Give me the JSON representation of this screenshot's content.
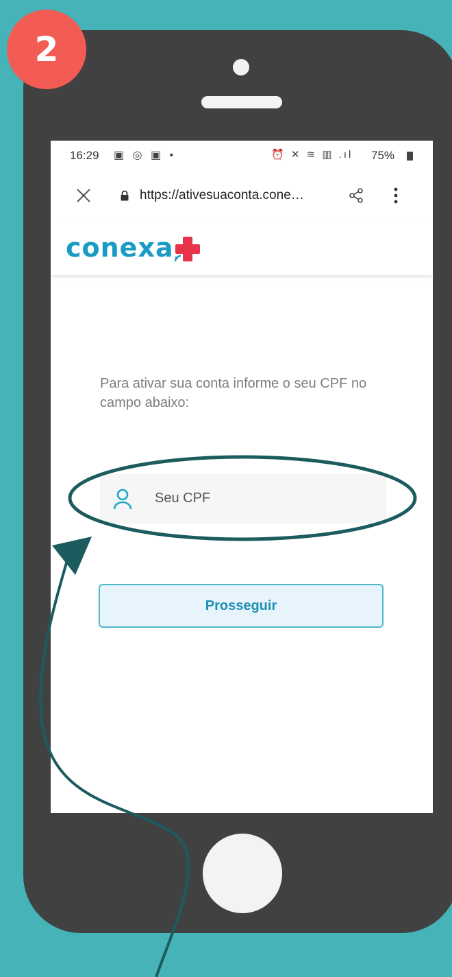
{
  "step": {
    "number": "2"
  },
  "status_bar": {
    "time": "16:29",
    "left_icons": "▣ ◎ ▣ •",
    "right_icons": "⏰ ✕ ≋ ▥ .ıl",
    "battery": "75%"
  },
  "browser": {
    "url": "https://ativesuaconta.cone…"
  },
  "site": {
    "logo_text": "conexa"
  },
  "form": {
    "instruction": "Para ativar sua conta informe o seu CPF no campo abaixo:",
    "cpf_placeholder": "Seu CPF",
    "proceed_label": "Prosseguir"
  },
  "colors": {
    "background": "#45b3b7",
    "phone_body": "#414141",
    "badge": "#f25c54",
    "logo_blue": "#1a9bc4",
    "logo_red": "#e8344a",
    "annotation": "#1c5b5e"
  },
  "icons": [
    "close-icon",
    "lock-icon",
    "share-icon",
    "menu-icon",
    "user-icon",
    "plus-logo-icon"
  ]
}
